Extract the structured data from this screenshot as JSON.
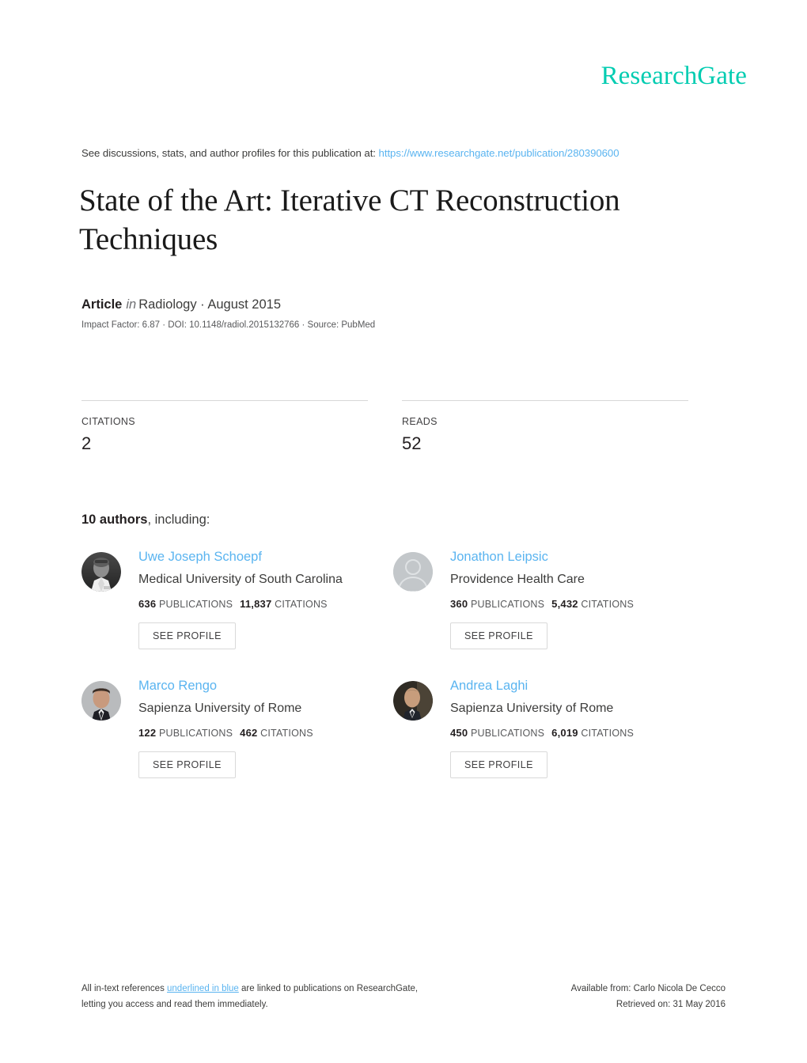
{
  "brand": {
    "logo_text": "ResearchGate",
    "accent_color": "#00ccb1",
    "link_color": "#5ab4f0"
  },
  "header": {
    "discussion_prefix": "See discussions, stats, and author profiles for this publication at:",
    "publication_url": "https://www.researchgate.net/publication/280390600"
  },
  "publication": {
    "title": "State of the Art: Iterative CT Reconstruction Techniques",
    "type_label": "Article",
    "in_word": "in",
    "venue": "Radiology · August 2015",
    "impact_line": "Impact Factor: 6.87 · DOI: 10.1148/radiol.2015132766 · Source: PubMed"
  },
  "metrics": [
    {
      "label": "CITATIONS",
      "value": "2"
    },
    {
      "label": "READS",
      "value": "52"
    }
  ],
  "authors_section": {
    "count_label": "10 authors",
    "suffix": ", including:",
    "see_profile_label": "SEE PROFILE"
  },
  "authors": [
    {
      "name": "Uwe Joseph Schoepf",
      "affiliation": "Medical University of South Carolina",
      "publications": "636",
      "publications_label": "PUBLICATIONS",
      "citations": "11,837",
      "citations_label": "CITATIONS",
      "avatar": "photo-grayscale-man-white-coat",
      "see_profile_label": "SEE PROFILE"
    },
    {
      "name": "Jonathon Leipsic",
      "affiliation": "Providence Health Care",
      "publications": "360",
      "publications_label": "PUBLICATIONS",
      "citations": "5,432",
      "citations_label": "CITATIONS",
      "avatar": "placeholder-silhouette",
      "see_profile_label": "SEE PROFILE"
    },
    {
      "name": "Marco Rengo",
      "affiliation": "Sapienza University of Rome",
      "publications": "122",
      "publications_label": "PUBLICATIONS",
      "citations": "462",
      "citations_label": "CITATIONS",
      "avatar": "photo-man-dark-hair-suit",
      "see_profile_label": "SEE PROFILE"
    },
    {
      "name": "Andrea Laghi",
      "affiliation": "Sapienza University of Rome",
      "publications": "450",
      "publications_label": "PUBLICATIONS",
      "citations": "6,019",
      "citations_label": "CITATIONS",
      "avatar": "photo-balding-man",
      "see_profile_label": "SEE PROFILE"
    }
  ],
  "footer": {
    "left_part1": "All in-text references ",
    "left_link": "underlined in blue",
    "left_part2": " are linked to publications on ResearchGate,",
    "left_line2": "letting you access and read them immediately.",
    "right_line1": "Available from: Carlo Nicola De Cecco",
    "right_line2": "Retrieved on: 31 May 2016"
  }
}
